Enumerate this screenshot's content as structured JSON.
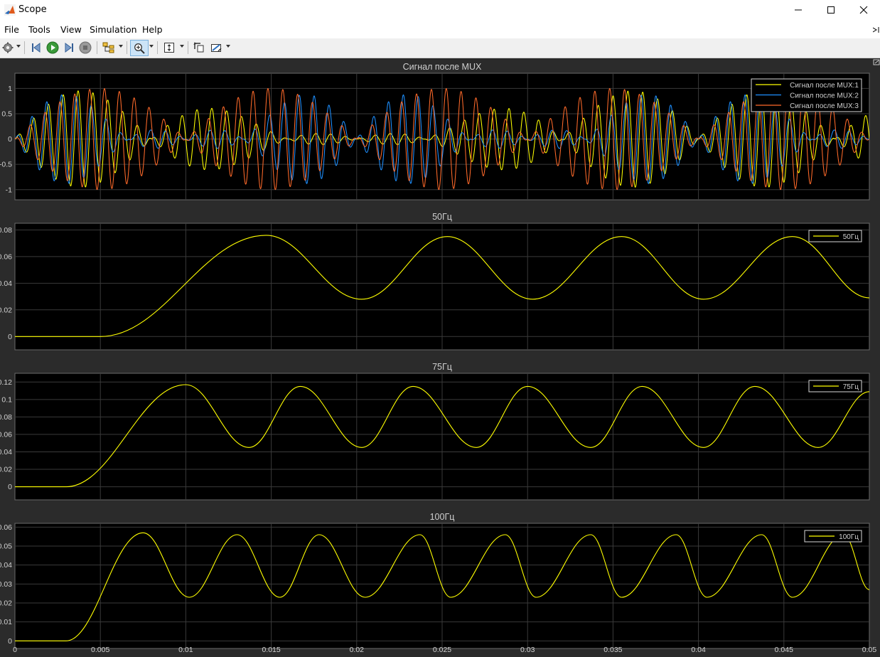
{
  "window": {
    "title": "Scope"
  },
  "menu": [
    "File",
    "Tools",
    "View",
    "Simulation",
    "Help"
  ],
  "toolbar": {
    "buttons": [
      "configuration-properties",
      "step-back",
      "run",
      "step-forward",
      "stop",
      "signal-hierarchy",
      "zoom-in",
      "scale-axes",
      "highlight-simulink-block",
      "measurements"
    ]
  },
  "colors": {
    "background": "#2b2b2b",
    "axes": "#000000",
    "grid": "#3a3a3a",
    "text": "#d0d0d0",
    "series_1": "#ffff00",
    "series_2": "#1e90ff",
    "series_3": "#ff6a2a"
  },
  "chart_data": [
    {
      "type": "line",
      "title": "Сигнал после MUX",
      "xlim": [
        0,
        0.05
      ],
      "ylim": [
        -1.2,
        1.3
      ],
      "yticks": [
        -1,
        -0.5,
        0,
        0.5,
        1
      ],
      "yticklabels": [
        "-1",
        "-0.5",
        "0",
        "0.5",
        "1"
      ],
      "grid": true,
      "legend_position": "top-right",
      "series": [
        {
          "name": "Сигнал после MUX:1",
          "color": "#ffff00",
          "frequency_hz": 1150,
          "envelope": "sum of 50Hz and 75Hz tones, amplitude 1"
        },
        {
          "name": "Сигнал после MUX:2",
          "color": "#1e90ff",
          "frequency_hz": 1150,
          "envelope": "sum of 50Hz and 100Hz tones, amplitude 1"
        },
        {
          "name": "Сигнал после MUX:3",
          "color": "#ff6a2a",
          "frequency_hz": 1150,
          "envelope": "|sin| with 0.02 s period, amplitude 1"
        }
      ]
    },
    {
      "type": "line",
      "title": "50Гц",
      "xlim": [
        0,
        0.05
      ],
      "ylim": [
        -0.01,
        0.085
      ],
      "yticks": [
        0,
        0.02,
        0.04,
        0.06,
        0.08
      ],
      "yticklabels": [
        "0",
        "0.02",
        "0.04",
        "0.06",
        "0.08"
      ],
      "grid": true,
      "legend_position": "top-right",
      "series": [
        {
          "name": "50Гц",
          "color": "#ffff00",
          "peaks": [
            [
              0.0147,
              0.076
            ],
            [
              0.0253,
              0.075
            ],
            [
              0.0355,
              0.075
            ],
            [
              0.0455,
              0.075
            ]
          ],
          "troughs": [
            [
              0.0203,
              0.028
            ],
            [
              0.0303,
              0.028
            ],
            [
              0.0403,
              0.028
            ]
          ],
          "rise_start": 0.005,
          "end_value": 0.029
        }
      ]
    },
    {
      "type": "line",
      "title": "75Гц",
      "xlim": [
        0,
        0.05
      ],
      "ylim": [
        -0.015,
        0.13
      ],
      "yticks": [
        0,
        0.02,
        0.04,
        0.06,
        0.08,
        0.1,
        0.12
      ],
      "yticklabels": [
        "0",
        "0.02",
        "0.04",
        "0.06",
        "0.08",
        "0.1",
        "0.12"
      ],
      "grid": true,
      "legend_position": "top-right",
      "series": [
        {
          "name": "75Гц",
          "color": "#ffff00",
          "peaks": [
            [
              0.01,
              0.117
            ],
            [
              0.0167,
              0.115
            ],
            [
              0.0233,
              0.115
            ],
            [
              0.03,
              0.115
            ],
            [
              0.0367,
              0.115
            ],
            [
              0.0433,
              0.115
            ]
          ],
          "troughs": [
            [
              0.0137,
              0.045
            ],
            [
              0.0203,
              0.045
            ],
            [
              0.027,
              0.045
            ],
            [
              0.0337,
              0.045
            ],
            [
              0.0403,
              0.045
            ],
            [
              0.047,
              0.045
            ]
          ],
          "rise_start": 0.003,
          "end_value": 0.109
        }
      ]
    },
    {
      "type": "line",
      "title": "100Гц",
      "xlim": [
        0,
        0.05
      ],
      "ylim": [
        -0.004,
        0.062
      ],
      "yticks": [
        0,
        0.01,
        0.02,
        0.03,
        0.04,
        0.05,
        0.06
      ],
      "yticklabels": [
        "0",
        "0.01",
        "0.02",
        "0.03",
        "0.04",
        "0.05",
        "0.06"
      ],
      "xticks": [
        0,
        0.005,
        0.01,
        0.015,
        0.02,
        0.025,
        0.03,
        0.035,
        0.04,
        0.045,
        0.05
      ],
      "xticklabels": [
        "0",
        "0.005",
        "0.01",
        "0.015",
        "0.02",
        "0.025",
        "0.03",
        "0.035",
        "0.04",
        "0.045",
        "0.05"
      ],
      "grid": true,
      "legend_position": "top-right",
      "series": [
        {
          "name": "100Гц",
          "color": "#ffff00",
          "peaks": [
            [
              0.0075,
              0.057
            ],
            [
              0.013,
              0.056
            ],
            [
              0.0178,
              0.056
            ],
            [
              0.0237,
              0.056
            ],
            [
              0.0287,
              0.056
            ],
            [
              0.0337,
              0.056
            ],
            [
              0.0387,
              0.056
            ],
            [
              0.0437,
              0.056
            ],
            [
              0.0485,
              0.056
            ]
          ],
          "troughs": [
            [
              0.0102,
              0.023
            ],
            [
              0.0155,
              0.023
            ],
            [
              0.0205,
              0.023
            ],
            [
              0.0255,
              0.023
            ],
            [
              0.0305,
              0.023
            ],
            [
              0.0355,
              0.023
            ],
            [
              0.0405,
              0.023
            ],
            [
              0.0455,
              0.023
            ]
          ],
          "rise_start": 0.003,
          "end_value": 0.027
        }
      ]
    }
  ]
}
